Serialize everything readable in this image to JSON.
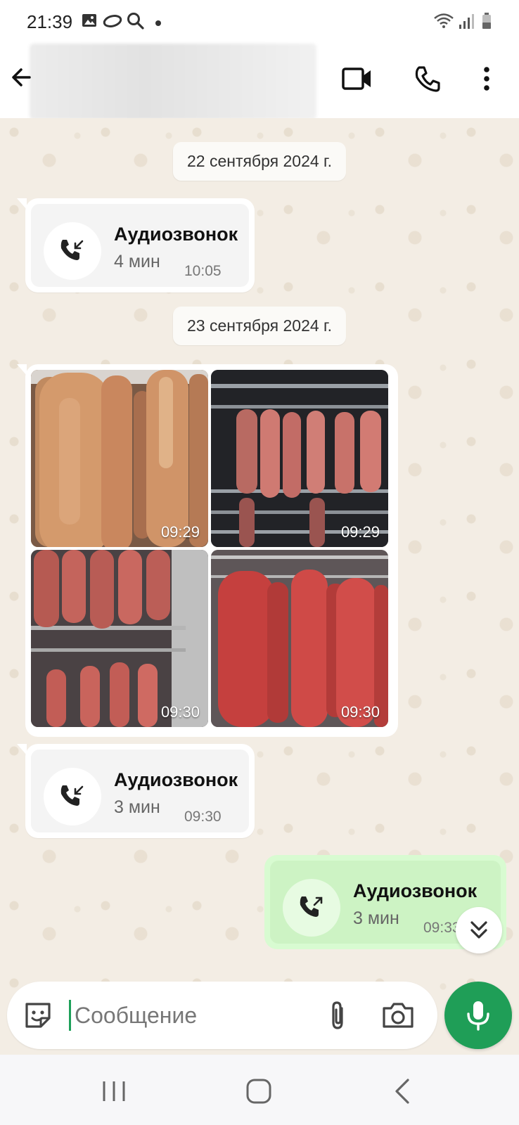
{
  "status_bar": {
    "time": "21:39",
    "icons": [
      "gallery-icon",
      "voicemail-icon",
      "search-icon",
      "dot-icon",
      "wifi-icon",
      "signal-icon",
      "battery-icon"
    ]
  },
  "header": {
    "contact_name": "",
    "icons": [
      "back-arrow-icon",
      "video-call-icon",
      "phone-icon",
      "more-vert-icon"
    ]
  },
  "messages": [
    {
      "type": "date",
      "label": "22 сентября 2024 г."
    },
    {
      "type": "call",
      "direction": "incoming",
      "title": "Аудиозвонок",
      "duration": "4 мин",
      "time": "10:05"
    },
    {
      "type": "date",
      "label": "23 сентября 2024 г."
    },
    {
      "type": "photos",
      "direction": "incoming",
      "photos": [
        {
          "time": "09:29"
        },
        {
          "time": "09:29"
        },
        {
          "time": "09:30"
        },
        {
          "time": "09:30"
        }
      ]
    },
    {
      "type": "call",
      "direction": "incoming",
      "title": "Аудиозвонок",
      "duration": "3 мин",
      "time": "09:30"
    },
    {
      "type": "call",
      "direction": "outgoing",
      "title": "Аудиозвонок",
      "duration": "3 мин",
      "time": "09:33"
    }
  ],
  "composer": {
    "placeholder": "Сообщение",
    "value": "",
    "icons": [
      "sticker-icon",
      "attach-icon",
      "camera-icon",
      "mic-icon"
    ]
  },
  "colors": {
    "accent": "#1f9e57",
    "chat_bg": "#f3ede4",
    "outgoing_bubble": "#d8fbd1",
    "incoming_bubble": "#ffffff"
  },
  "nav_bar": {
    "icons": [
      "recents-icon",
      "home-icon",
      "back-icon"
    ]
  }
}
